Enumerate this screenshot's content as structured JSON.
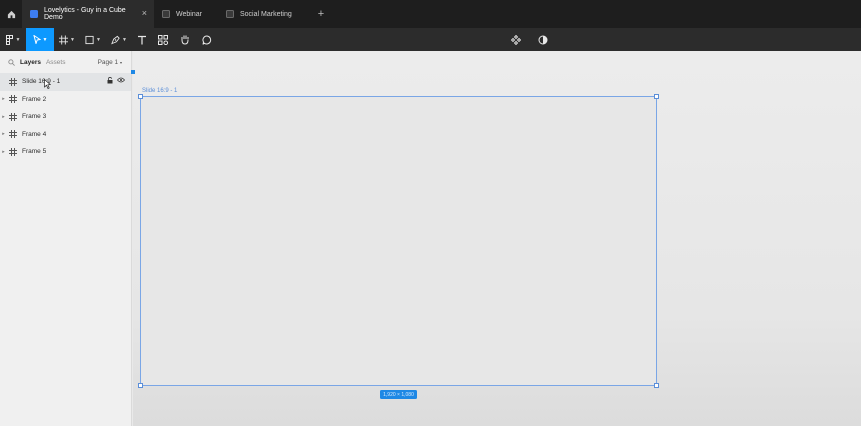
{
  "tabs": [
    {
      "label": "Lovelytics - Guy in a Cube Demo",
      "active": true
    },
    {
      "label": "Webinar",
      "active": false
    },
    {
      "label": "Social Marketing",
      "active": false
    }
  ],
  "toolbar": {
    "icons": [
      "figma-menu-icon",
      "move-tool-icon",
      "frame-tool-icon",
      "shape-tool-icon",
      "pen-tool-icon",
      "text-tool-icon",
      "resources-icon",
      "hand-tool-icon",
      "comment-tool-icon",
      "component-icon",
      "contrast-icon"
    ],
    "accent": "#0d99ff"
  },
  "left_panel": {
    "tabs": {
      "layers": "Layers",
      "assets": "Assets"
    },
    "page_selector": "Page 1",
    "layers": [
      {
        "label": "Slide 16:9 - 1",
        "selected": true
      },
      {
        "label": "Frame 2",
        "selected": false
      },
      {
        "label": "Frame 3",
        "selected": false
      },
      {
        "label": "Frame 4",
        "selected": false
      },
      {
        "label": "Frame 5",
        "selected": false
      }
    ]
  },
  "canvas": {
    "frame_label": "Slide 16:9 - 1",
    "dimensions": "1,920 × 1,080",
    "selection_color": "#1e88e5"
  }
}
